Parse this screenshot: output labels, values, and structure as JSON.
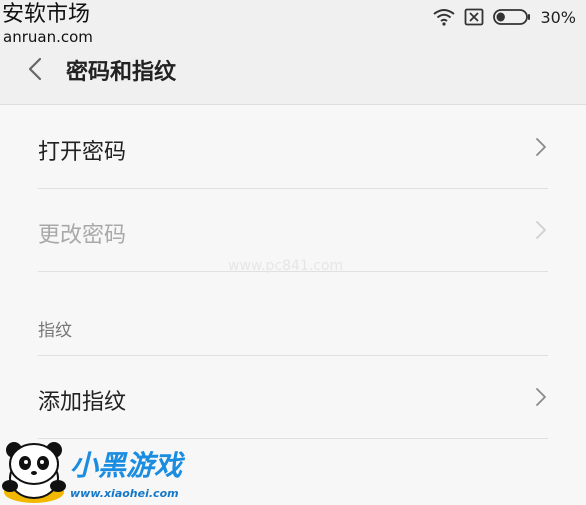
{
  "watermarks": {
    "top_left_cn": "安软市场",
    "top_left_url": "anruan.com",
    "center_faint": "www.pc841.com",
    "logo_text": "小黑游戏",
    "logo_url": "www.xiaohei.com"
  },
  "status_bar": {
    "battery_percent": "30%",
    "battery_level": 0.3,
    "icons": [
      "wifi-icon",
      "no-sim-icon",
      "battery-icon"
    ]
  },
  "header": {
    "back_icon": "chevron-left-icon",
    "title": "密码和指纹"
  },
  "list": {
    "items": [
      {
        "label": "打开密码",
        "enabled": true,
        "icon": "chevron-right-icon"
      },
      {
        "label": "更改密码",
        "enabled": false,
        "icon": "chevron-right-icon"
      }
    ],
    "section_header": "指纹",
    "fingerprint_items": [
      {
        "label": "添加指纹",
        "enabled": true,
        "icon": "chevron-right-icon"
      }
    ]
  },
  "colors": {
    "background": "#f7f7f7",
    "header_background": "#f0f0f0",
    "disabled_text": "#a9a9a9",
    "divider": "#e0e0e0",
    "logo_blue": "#1a8de0"
  }
}
